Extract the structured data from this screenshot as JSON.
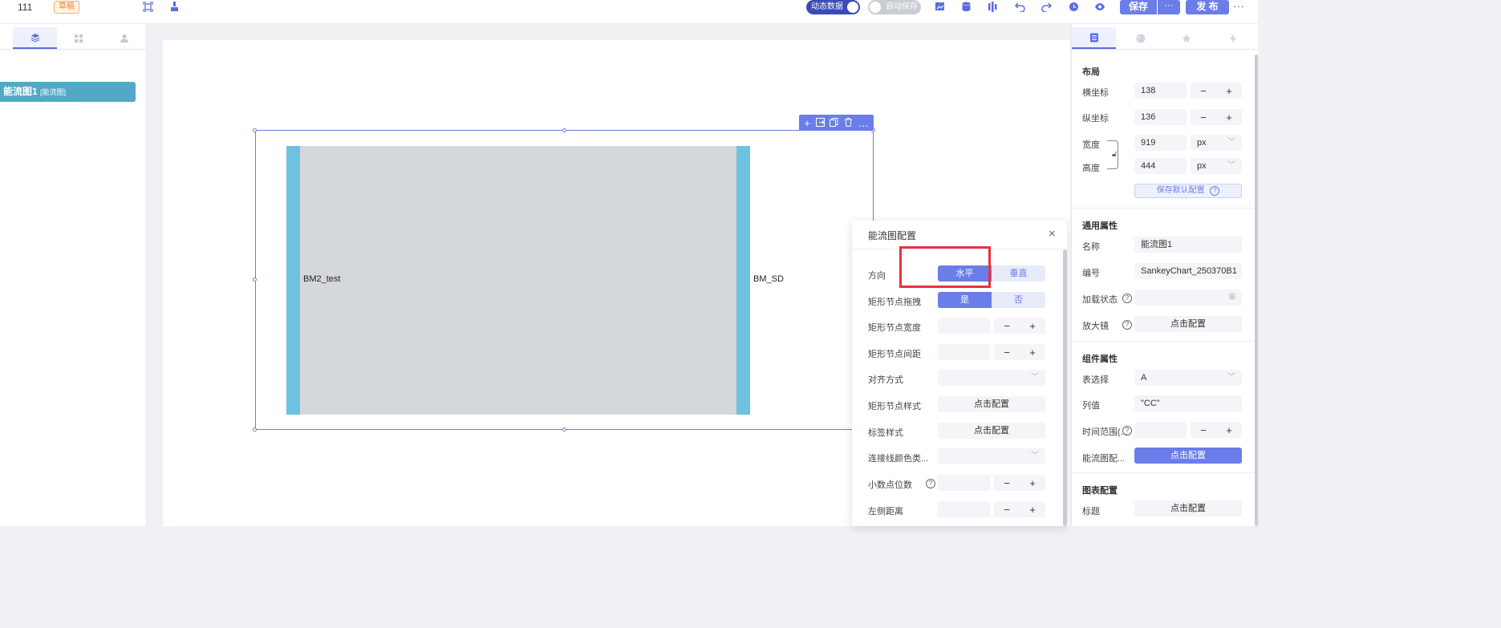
{
  "topbar": {
    "project_name": "111",
    "status_badge": "草稿",
    "dynamic_data_label": "动态数据",
    "auto_save_label": "自动保存",
    "save_label": "保存",
    "save_more": "···",
    "publish_label": "发 布",
    "more": "···"
  },
  "layers": {
    "item_name": "能流图1",
    "item_type": "[能流图]"
  },
  "canvas": {
    "left_node_label": "BM2_test",
    "right_node_label": "BM_SD"
  },
  "popup": {
    "title": "能流图配置",
    "close": "×",
    "rows": [
      {
        "label": "方向"
      },
      {
        "label": "矩形节点拖拽"
      },
      {
        "label": "矩形节点宽度"
      },
      {
        "label": "矩形节点间距"
      },
      {
        "label": "对齐方式"
      },
      {
        "label": "矩形节点样式"
      },
      {
        "label": "标签样式"
      },
      {
        "label": "连接线颜色类..."
      },
      {
        "label": "小数点位数"
      },
      {
        "label": "左侧距离"
      }
    ],
    "direction": {
      "horizontal": "水平",
      "vertical": "垂直",
      "selected": "水平"
    },
    "drag": {
      "yes": "是",
      "no": "否",
      "selected": "是"
    },
    "stepper_minus": "−",
    "stepper_plus": "+",
    "config_label": "点击配置"
  },
  "rightpanel": {
    "layout_title": "布局",
    "x_label": "横坐标",
    "x_value": "138",
    "y_label": "纵坐标",
    "y_value": "136",
    "width_label": "宽度",
    "width_value": "919",
    "width_unit": "px",
    "height_label": "高度",
    "height_value": "444",
    "height_unit": "px",
    "save_default": "保存默认配置",
    "common_title": "通用属性",
    "name_label": "名称",
    "name_value": "能流图1",
    "id_label": "编号",
    "id_value": "SankeyChart_250370B1",
    "loading_label": "加载状态",
    "magnifier_label": "放大镜",
    "config_label": "点击配置",
    "component_title": "组件属性",
    "table_select_label": "表选择",
    "table_select_value": "A",
    "column_label": "列值",
    "column_value": "\"CC\"",
    "time_range_label": "时间范围(...",
    "sankey_config_label": "能流图配...",
    "chart_config_title": "图表配置",
    "title_label": "标题",
    "minus": "−",
    "plus": "+"
  }
}
